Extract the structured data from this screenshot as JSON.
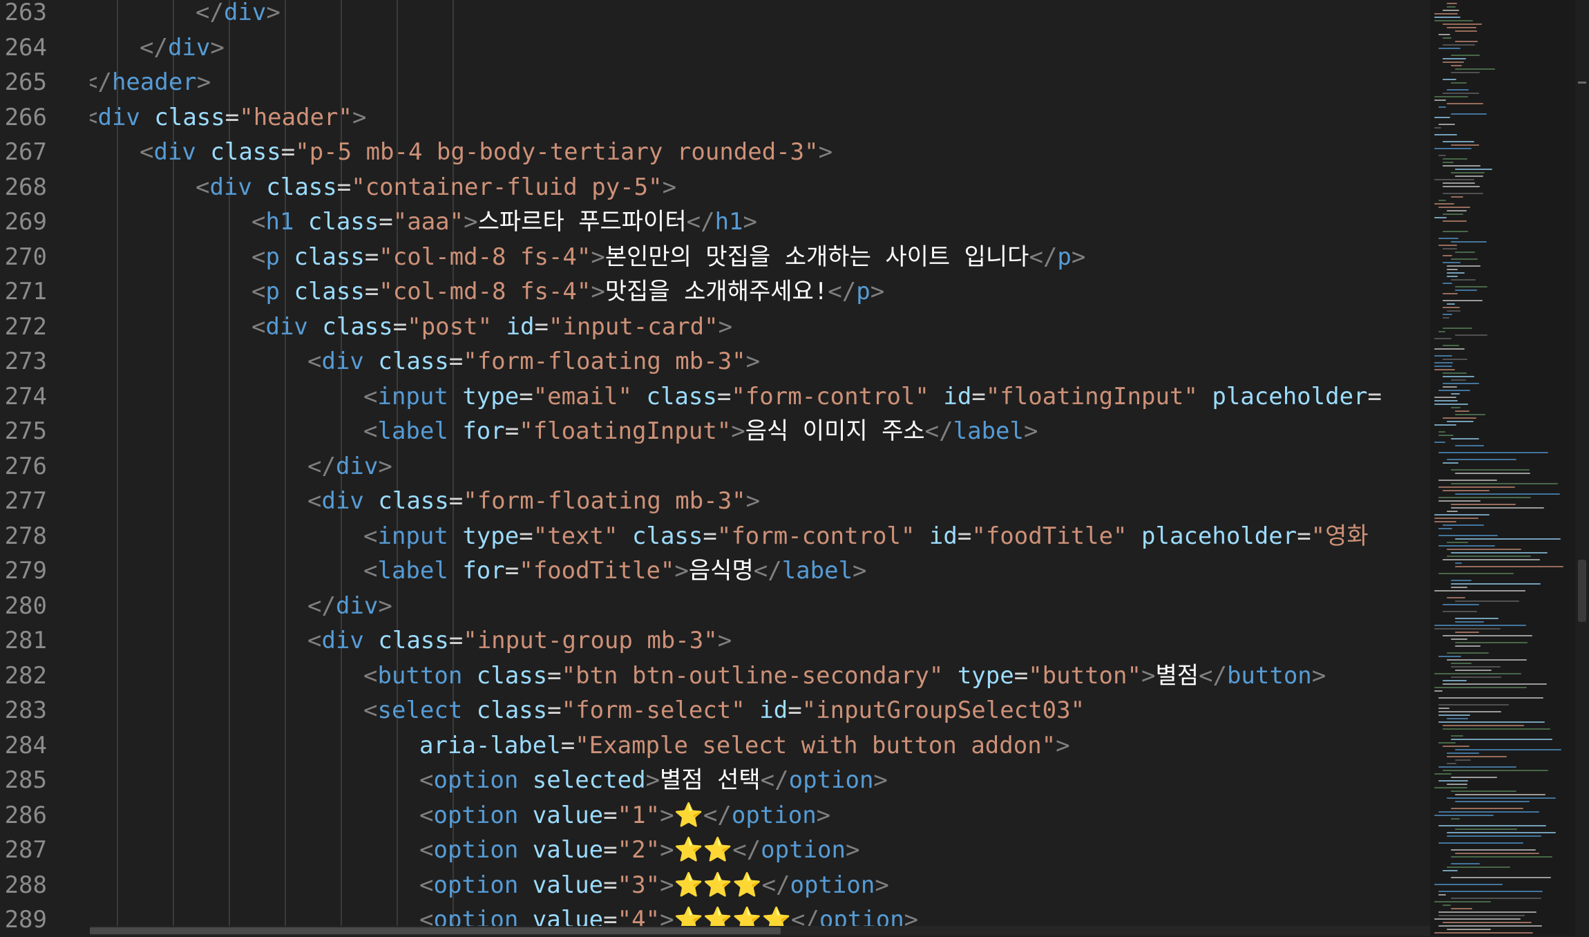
{
  "editor": {
    "language": "html",
    "lines": [
      {
        "number": "263",
        "indent": 3,
        "tokens": [
          [
            "p",
            "</"
          ],
          [
            "tag",
            "div"
          ],
          [
            "p",
            ">"
          ]
        ]
      },
      {
        "number": "264",
        "indent": 2,
        "tokens": [
          [
            "p",
            "</"
          ],
          [
            "tag",
            "div"
          ],
          [
            "p",
            ">"
          ]
        ]
      },
      {
        "number": "265",
        "indent": 1,
        "tokens": [
          [
            "p",
            "</"
          ],
          [
            "tag",
            "header"
          ],
          [
            "p",
            ">"
          ]
        ]
      },
      {
        "number": "266",
        "indent": 1,
        "tokens": [
          [
            "p",
            "<"
          ],
          [
            "tag",
            "div"
          ],
          [
            "txt",
            " "
          ],
          [
            "attr",
            "class"
          ],
          [
            "op",
            "="
          ],
          [
            "str",
            "\"header\""
          ],
          [
            "p",
            ">"
          ]
        ]
      },
      {
        "number": "267",
        "indent": 2,
        "tokens": [
          [
            "p",
            "<"
          ],
          [
            "tag",
            "div"
          ],
          [
            "txt",
            " "
          ],
          [
            "attr",
            "class"
          ],
          [
            "op",
            "="
          ],
          [
            "str",
            "\"p-5 mb-4 bg-body-tertiary rounded-3\""
          ],
          [
            "p",
            ">"
          ]
        ]
      },
      {
        "number": "268",
        "indent": 3,
        "tokens": [
          [
            "p",
            "<"
          ],
          [
            "tag",
            "div"
          ],
          [
            "txt",
            " "
          ],
          [
            "attr",
            "class"
          ],
          [
            "op",
            "="
          ],
          [
            "str",
            "\"container-fluid py-5\""
          ],
          [
            "p",
            ">"
          ]
        ]
      },
      {
        "number": "269",
        "indent": 4,
        "tokens": [
          [
            "p",
            "<"
          ],
          [
            "tag",
            "h1"
          ],
          [
            "txt",
            " "
          ],
          [
            "attr",
            "class"
          ],
          [
            "op",
            "="
          ],
          [
            "str",
            "\"aaa\""
          ],
          [
            "p",
            ">"
          ],
          [
            "txt",
            "스파르타 푸드파이터"
          ],
          [
            "p",
            "</"
          ],
          [
            "tag",
            "h1"
          ],
          [
            "p",
            ">"
          ]
        ]
      },
      {
        "number": "270",
        "indent": 4,
        "tokens": [
          [
            "p",
            "<"
          ],
          [
            "tag",
            "p"
          ],
          [
            "txt",
            " "
          ],
          [
            "attr",
            "class"
          ],
          [
            "op",
            "="
          ],
          [
            "str",
            "\"col-md-8 fs-4\""
          ],
          [
            "p",
            ">"
          ],
          [
            "txt",
            "본인만의 맛집을 소개하는 사이트 입니다"
          ],
          [
            "p",
            "</"
          ],
          [
            "tag",
            "p"
          ],
          [
            "p",
            ">"
          ]
        ]
      },
      {
        "number": "271",
        "indent": 4,
        "tokens": [
          [
            "p",
            "<"
          ],
          [
            "tag",
            "p"
          ],
          [
            "txt",
            " "
          ],
          [
            "attr",
            "class"
          ],
          [
            "op",
            "="
          ],
          [
            "str",
            "\"col-md-8 fs-4\""
          ],
          [
            "p",
            ">"
          ],
          [
            "txt",
            "맛집을 소개해주세요!"
          ],
          [
            "p",
            "</"
          ],
          [
            "tag",
            "p"
          ],
          [
            "p",
            ">"
          ]
        ]
      },
      {
        "number": "272",
        "indent": 4,
        "tokens": [
          [
            "p",
            "<"
          ],
          [
            "tag",
            "div"
          ],
          [
            "txt",
            " "
          ],
          [
            "attr",
            "class"
          ],
          [
            "op",
            "="
          ],
          [
            "str",
            "\"post\""
          ],
          [
            "txt",
            " "
          ],
          [
            "attr",
            "id"
          ],
          [
            "op",
            "="
          ],
          [
            "str",
            "\"input-card\""
          ],
          [
            "p",
            ">"
          ]
        ]
      },
      {
        "number": "273",
        "indent": 5,
        "tokens": [
          [
            "p",
            "<"
          ],
          [
            "tag",
            "div"
          ],
          [
            "txt",
            " "
          ],
          [
            "attr",
            "class"
          ],
          [
            "op",
            "="
          ],
          [
            "str",
            "\"form-floating mb-3\""
          ],
          [
            "p",
            ">"
          ]
        ]
      },
      {
        "number": "274",
        "indent": 6,
        "tokens": [
          [
            "p",
            "<"
          ],
          [
            "tag",
            "input"
          ],
          [
            "txt",
            " "
          ],
          [
            "attr",
            "type"
          ],
          [
            "op",
            "="
          ],
          [
            "str",
            "\"email\""
          ],
          [
            "txt",
            " "
          ],
          [
            "attr",
            "class"
          ],
          [
            "op",
            "="
          ],
          [
            "str",
            "\"form-control\""
          ],
          [
            "txt",
            " "
          ],
          [
            "attr",
            "id"
          ],
          [
            "op",
            "="
          ],
          [
            "str",
            "\"floatingInput\""
          ],
          [
            "txt",
            " "
          ],
          [
            "attr",
            "placeholder"
          ],
          [
            "op",
            "="
          ]
        ]
      },
      {
        "number": "275",
        "indent": 6,
        "tokens": [
          [
            "p",
            "<"
          ],
          [
            "tag",
            "label"
          ],
          [
            "txt",
            " "
          ],
          [
            "attr",
            "for"
          ],
          [
            "op",
            "="
          ],
          [
            "str",
            "\"floatingInput\""
          ],
          [
            "p",
            ">"
          ],
          [
            "txt",
            "음식 이미지 주소"
          ],
          [
            "p",
            "</"
          ],
          [
            "tag",
            "label"
          ],
          [
            "p",
            ">"
          ]
        ]
      },
      {
        "number": "276",
        "indent": 5,
        "tokens": [
          [
            "p",
            "</"
          ],
          [
            "tag",
            "div"
          ],
          [
            "p",
            ">"
          ]
        ]
      },
      {
        "number": "277",
        "indent": 5,
        "tokens": [
          [
            "p",
            "<"
          ],
          [
            "tag",
            "div"
          ],
          [
            "txt",
            " "
          ],
          [
            "attr",
            "class"
          ],
          [
            "op",
            "="
          ],
          [
            "str",
            "\"form-floating mb-3\""
          ],
          [
            "p",
            ">"
          ]
        ]
      },
      {
        "number": "278",
        "indent": 6,
        "tokens": [
          [
            "p",
            "<"
          ],
          [
            "tag",
            "input"
          ],
          [
            "txt",
            " "
          ],
          [
            "attr",
            "type"
          ],
          [
            "op",
            "="
          ],
          [
            "str",
            "\"text\""
          ],
          [
            "txt",
            " "
          ],
          [
            "attr",
            "class"
          ],
          [
            "op",
            "="
          ],
          [
            "str",
            "\"form-control\""
          ],
          [
            "txt",
            " "
          ],
          [
            "attr",
            "id"
          ],
          [
            "op",
            "="
          ],
          [
            "str",
            "\"foodTitle\""
          ],
          [
            "txt",
            " "
          ],
          [
            "attr",
            "placeholder"
          ],
          [
            "op",
            "="
          ],
          [
            "str",
            "\"영화"
          ]
        ]
      },
      {
        "number": "279",
        "indent": 6,
        "tokens": [
          [
            "p",
            "<"
          ],
          [
            "tag",
            "label"
          ],
          [
            "txt",
            " "
          ],
          [
            "attr",
            "for"
          ],
          [
            "op",
            "="
          ],
          [
            "str",
            "\"foodTitle\""
          ],
          [
            "p",
            ">"
          ],
          [
            "txt",
            "음식명"
          ],
          [
            "p",
            "</"
          ],
          [
            "tag",
            "label"
          ],
          [
            "p",
            ">"
          ]
        ]
      },
      {
        "number": "280",
        "indent": 5,
        "tokens": [
          [
            "p",
            "</"
          ],
          [
            "tag",
            "div"
          ],
          [
            "p",
            ">"
          ]
        ]
      },
      {
        "number": "281",
        "indent": 5,
        "tokens": [
          [
            "p",
            "<"
          ],
          [
            "tag",
            "div"
          ],
          [
            "txt",
            " "
          ],
          [
            "attr",
            "class"
          ],
          [
            "op",
            "="
          ],
          [
            "str",
            "\"input-group mb-3\""
          ],
          [
            "p",
            ">"
          ]
        ]
      },
      {
        "number": "282",
        "indent": 6,
        "tokens": [
          [
            "p",
            "<"
          ],
          [
            "tag",
            "button"
          ],
          [
            "txt",
            " "
          ],
          [
            "attr",
            "class"
          ],
          [
            "op",
            "="
          ],
          [
            "str",
            "\"btn btn-outline-secondary\""
          ],
          [
            "txt",
            " "
          ],
          [
            "attr",
            "type"
          ],
          [
            "op",
            "="
          ],
          [
            "str",
            "\"button\""
          ],
          [
            "p",
            ">"
          ],
          [
            "txt",
            "별점"
          ],
          [
            "p",
            "</"
          ],
          [
            "tag",
            "button"
          ],
          [
            "p",
            ">"
          ]
        ]
      },
      {
        "number": "283",
        "indent": 6,
        "tokens": [
          [
            "p",
            "<"
          ],
          [
            "tag",
            "select"
          ],
          [
            "txt",
            " "
          ],
          [
            "attr",
            "class"
          ],
          [
            "op",
            "="
          ],
          [
            "str",
            "\"form-select\""
          ],
          [
            "txt",
            " "
          ],
          [
            "attr",
            "id"
          ],
          [
            "op",
            "="
          ],
          [
            "str",
            "\"inputGroupSelect03\""
          ]
        ]
      },
      {
        "number": "284",
        "indent": 7,
        "tokens": [
          [
            "attr",
            "aria-label"
          ],
          [
            "op",
            "="
          ],
          [
            "str",
            "\"Example select with button addon\""
          ],
          [
            "p",
            ">"
          ]
        ]
      },
      {
        "number": "285",
        "indent": 7,
        "tokens": [
          [
            "p",
            "<"
          ],
          [
            "tag",
            "option"
          ],
          [
            "txt",
            " "
          ],
          [
            "attr",
            "selected"
          ],
          [
            "p",
            ">"
          ],
          [
            "txt",
            "별점 선택"
          ],
          [
            "p",
            "</"
          ],
          [
            "tag",
            "option"
          ],
          [
            "p",
            ">"
          ]
        ]
      },
      {
        "number": "286",
        "indent": 7,
        "tokens": [
          [
            "p",
            "<"
          ],
          [
            "tag",
            "option"
          ],
          [
            "txt",
            " "
          ],
          [
            "attr",
            "value"
          ],
          [
            "op",
            "="
          ],
          [
            "str",
            "\"1\""
          ],
          [
            "p",
            ">"
          ],
          [
            "emo",
            "⭐"
          ],
          [
            "p",
            "</"
          ],
          [
            "tag",
            "option"
          ],
          [
            "p",
            ">"
          ]
        ]
      },
      {
        "number": "287",
        "indent": 7,
        "tokens": [
          [
            "p",
            "<"
          ],
          [
            "tag",
            "option"
          ],
          [
            "txt",
            " "
          ],
          [
            "attr",
            "value"
          ],
          [
            "op",
            "="
          ],
          [
            "str",
            "\"2\""
          ],
          [
            "p",
            ">"
          ],
          [
            "emo",
            "⭐⭐"
          ],
          [
            "p",
            "</"
          ],
          [
            "tag",
            "option"
          ],
          [
            "p",
            ">"
          ]
        ]
      },
      {
        "number": "288",
        "indent": 7,
        "tokens": [
          [
            "p",
            "<"
          ],
          [
            "tag",
            "option"
          ],
          [
            "txt",
            " "
          ],
          [
            "attr",
            "value"
          ],
          [
            "op",
            "="
          ],
          [
            "str",
            "\"3\""
          ],
          [
            "p",
            ">"
          ],
          [
            "emo",
            "⭐⭐⭐"
          ],
          [
            "p",
            "</"
          ],
          [
            "tag",
            "option"
          ],
          [
            "p",
            ">"
          ]
        ]
      },
      {
        "number": "289",
        "indent": 7,
        "tokens": [
          [
            "p",
            "<"
          ],
          [
            "tag",
            "option"
          ],
          [
            "txt",
            " "
          ],
          [
            "attr",
            "value"
          ],
          [
            "op",
            "="
          ],
          [
            "str",
            "\"4\""
          ],
          [
            "p",
            ">"
          ],
          [
            "emo",
            "⭐⭐⭐⭐"
          ],
          [
            "p",
            "</"
          ],
          [
            "tag",
            "option"
          ],
          [
            "p",
            ">"
          ]
        ]
      }
    ]
  },
  "colors": {
    "background": "#1f1f1f",
    "line_number": "#8c8c8c",
    "punctuation": "#808080",
    "tag": "#569cd6",
    "attribute": "#9cdcfe",
    "string": "#ce9178",
    "text": "#ffffff",
    "emoji": "#f5c518"
  }
}
